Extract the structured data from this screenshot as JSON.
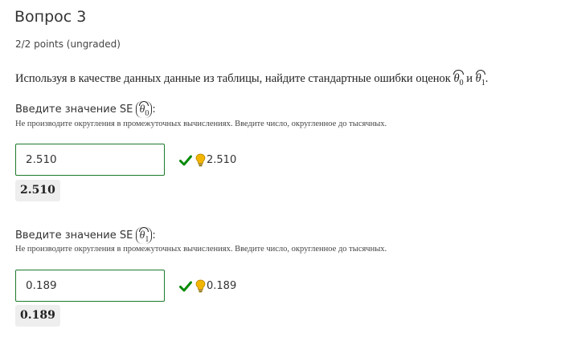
{
  "question": {
    "title": "Вопрос 3",
    "points": "2/2 points (ungraded)",
    "prompt_text": "Используя в качестве данных данные из таблицы, найдите стандартные ошибки оценок",
    "theta0_symbol": "θ",
    "theta0_sub": "0",
    "conjunction": "и",
    "theta1_symbol": "θ",
    "theta1_sub": "1",
    "period": "."
  },
  "fields": [
    {
      "label_prefix": "Введите значение SE",
      "symbol": "θ",
      "sub": "0",
      "label_suffix": ":",
      "hint": "Не производите округления в промежуточных вычислениях. Введите число, округленное до тысячных.",
      "value": "2.510",
      "feedback_value": "2.510",
      "preview": "2.510",
      "status": "correct"
    },
    {
      "label_prefix": "Введите значение SE",
      "symbol": "θ",
      "sub": "1",
      "label_suffix": ":",
      "hint": "Не производите округления в промежуточных вычислениях. Введите число, округленное до тысячных.",
      "value": "0.189",
      "feedback_value": "0.189",
      "preview": "0.189",
      "status": "correct"
    }
  ],
  "colors": {
    "correct_green": "#1b7a2b",
    "check_green": "#0a8a0a",
    "bulb_yellow": "#f3b600"
  },
  "icons": {
    "check": "check-icon",
    "hint": "lightbulb-icon"
  }
}
